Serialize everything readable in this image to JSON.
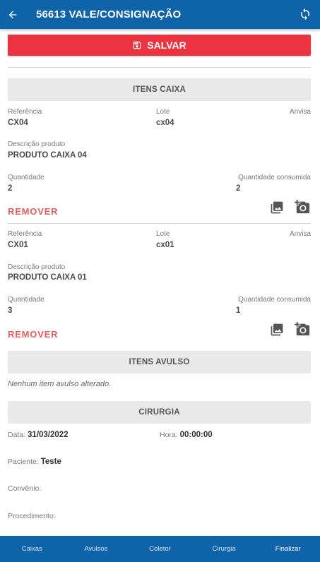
{
  "header": {
    "title": "56613 VALE/CONSIGNAÇÃO",
    "back_icon": "arrow-left-icon",
    "refresh_icon": "refresh-icon"
  },
  "toolbar": {
    "save_label": "SALVAR",
    "save_icon": "floppy-disk-icon",
    "save_color": "#ee3340"
  },
  "sections": {
    "itens_caixa": "ITENS CAIXA",
    "itens_avulso": "ITENS AVULSO",
    "cirurgia": "CIRURGIA"
  },
  "labels": {
    "referencia": "Referência",
    "lote": "Lote",
    "anvisa": "Anvisa",
    "descricao": "Descrição produto",
    "quantidade": "Quantidade",
    "quantidade_consumida": "Quantidade consumida",
    "remover": "REMOVER"
  },
  "items": [
    {
      "referencia": "CX04",
      "lote": "cx04",
      "anvisa": "",
      "descricao": "PRODUTO CAIXA 04",
      "quantidade": "2",
      "quantidade_consumida": "2"
    },
    {
      "referencia": "CX01",
      "lote": "cx01",
      "anvisa": "",
      "descricao": "PRODUTO CAIXA 01",
      "quantidade": "3",
      "quantidade_consumida": "1"
    }
  ],
  "avulso": {
    "empty_message": "Nenhum item avulso alterado."
  },
  "cirurgia": {
    "data_label": "Data:",
    "data_value": "31/03/2022",
    "hora_label": "Hora:",
    "hora_value": "00:00:00",
    "paciente_label": "Paciente:",
    "paciente_value": "Teste",
    "convenio_label": "Convênio:",
    "convenio_value": "",
    "procedimento_label": "Procedimento:",
    "procedimento_value": ""
  },
  "bottom_nav": {
    "items": [
      "Caixas",
      "Avulsos",
      "Coletor",
      "Cirurgia",
      "Finalizar"
    ],
    "active": "Finalizar"
  },
  "colors": {
    "primary": "#0f63a8",
    "danger": "#ee3340",
    "remove_text": "#e06060"
  }
}
